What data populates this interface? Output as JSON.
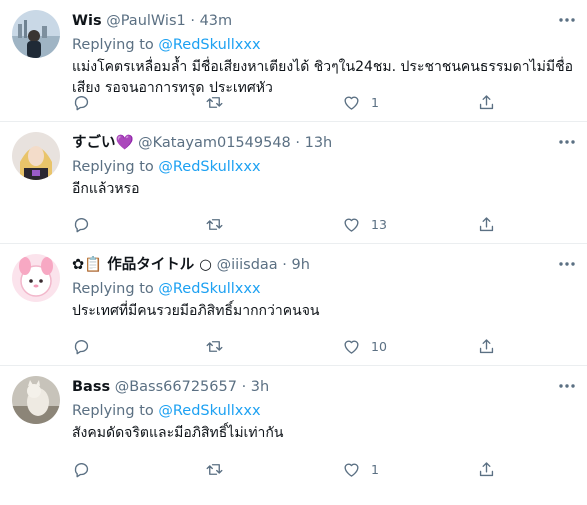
{
  "tweets": [
    {
      "name": "Wis",
      "emoji": "",
      "handle": "@PaulWis1",
      "dot": "·",
      "time": "43m",
      "replying_prefix": "Replying to",
      "replying_to": "@RedSkullxxx",
      "text": "แม่งโคตรเหลื่อมล้ำ มีชื่อเสียงหาเตียงได้ ชิวๆใน24ชม. ประชาชนคนธรรมดาไม่มีชื่อเสียง รอจนอาการทรุด ประเทศหัว",
      "replies": "",
      "retweets": "",
      "likes": "1"
    },
    {
      "name": "すごい",
      "emoji": "💜",
      "handle": "@Katayam01549548",
      "dot": "·",
      "time": "13h",
      "replying_prefix": "Replying to",
      "replying_to": "@RedSkullxxx",
      "text": "อีกแล้วหรอ",
      "replies": "",
      "retweets": "",
      "likes": "13"
    },
    {
      "name": "✿📋 作品タイトル ○",
      "emoji": "",
      "handle": "@iiisdaa",
      "dot": "·",
      "time": "9h",
      "replying_prefix": "Replying to",
      "replying_to": "@RedSkullxxx",
      "text": "ประเทศที่มีคนรวยมีอภิสิทธิ์มากกว่าคนจน",
      "replies": "",
      "retweets": "",
      "likes": "10"
    },
    {
      "name": "Bass",
      "emoji": "",
      "handle": "@Bass66725657",
      "dot": "·",
      "time": "3h",
      "replying_prefix": "Replying to",
      "replying_to": "@RedSkullxxx",
      "text": "สังคมดัดจริตและมีอภิสิทธิ์ไม่เท่ากัน",
      "replies": "",
      "retweets": "",
      "likes": "1"
    }
  ],
  "icons": {
    "reply": "reply-icon",
    "retweet": "retweet-icon",
    "like": "like-icon",
    "share": "share-icon",
    "more": "more-icon"
  },
  "colors": {
    "accent": "#1da1f2",
    "muted": "#5b7083",
    "text": "#0f1419",
    "divider": "#ebeef0"
  }
}
